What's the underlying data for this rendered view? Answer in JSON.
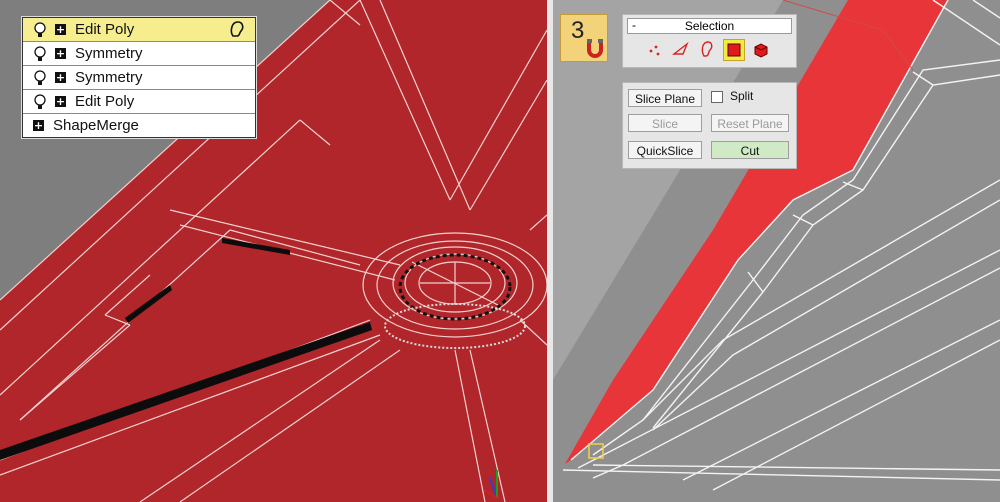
{
  "modifier_stack": [
    {
      "label": "Edit Poly",
      "active": true,
      "show_bulb": true
    },
    {
      "label": "Symmetry",
      "active": false,
      "show_bulb": true
    },
    {
      "label": "Symmetry",
      "active": false,
      "show_bulb": true
    },
    {
      "label": "Edit Poly",
      "active": false,
      "show_bulb": true
    },
    {
      "label": "ShapeMerge",
      "active": false,
      "show_bulb": false
    }
  ],
  "logo": {
    "number": "3"
  },
  "selection_panel": {
    "collapse": "-",
    "title": "Selection",
    "modes": [
      {
        "icon": "vertex-icon",
        "selected": false
      },
      {
        "icon": "edge-icon",
        "selected": false
      },
      {
        "icon": "border-icon",
        "selected": false
      },
      {
        "icon": "polygon-icon",
        "selected": true
      },
      {
        "icon": "element-icon",
        "selected": false
      }
    ]
  },
  "edit_geometry": {
    "slice_plane": "Slice Plane",
    "split": "Split",
    "slice": "Slice",
    "reset_plane": "Reset Plane",
    "quickslice": "QuickSlice",
    "cut": "Cut"
  },
  "colors": {
    "model_red": "#b0262a",
    "active_highlight": "#f6ed8f",
    "cut_active": "#cfeac4",
    "logo": "#f3d37a"
  }
}
